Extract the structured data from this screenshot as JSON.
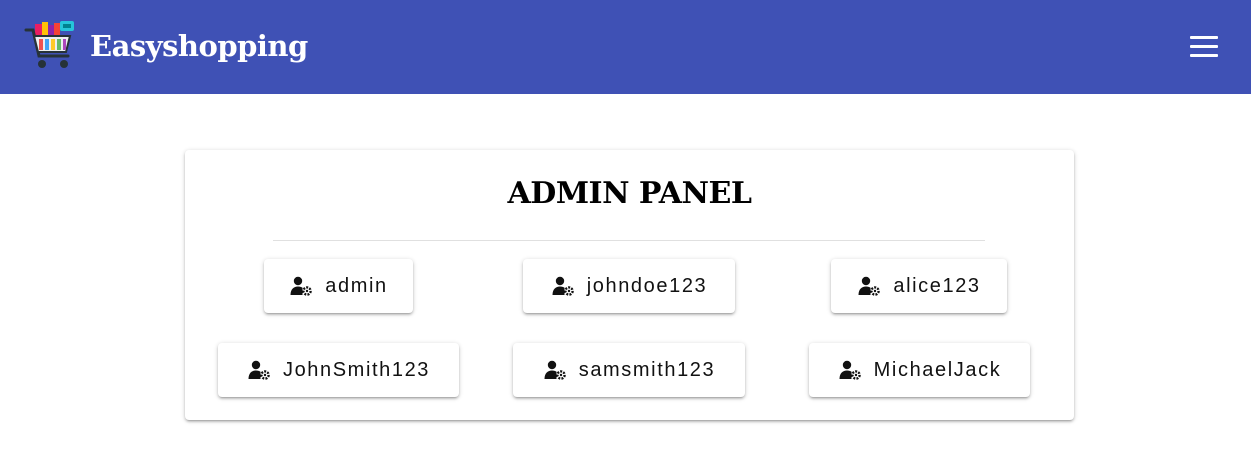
{
  "navbar": {
    "brand": "Easyshopping",
    "brand_icon": "shopping-cart-logo",
    "menu_icon": "hamburger-menu-icon",
    "background": "#3f51b5"
  },
  "panel": {
    "title": "ADMIN PANEL"
  },
  "users": [
    {
      "label": "admin",
      "icon": "user-cog-icon"
    },
    {
      "label": "johndoe123",
      "icon": "user-cog-icon"
    },
    {
      "label": "alice123",
      "icon": "user-cog-icon"
    },
    {
      "label": "JohnSmith123",
      "icon": "user-cog-icon"
    },
    {
      "label": "samsmith123",
      "icon": "user-cog-icon"
    },
    {
      "label": "MichaelJack",
      "icon": "user-cog-icon"
    }
  ]
}
